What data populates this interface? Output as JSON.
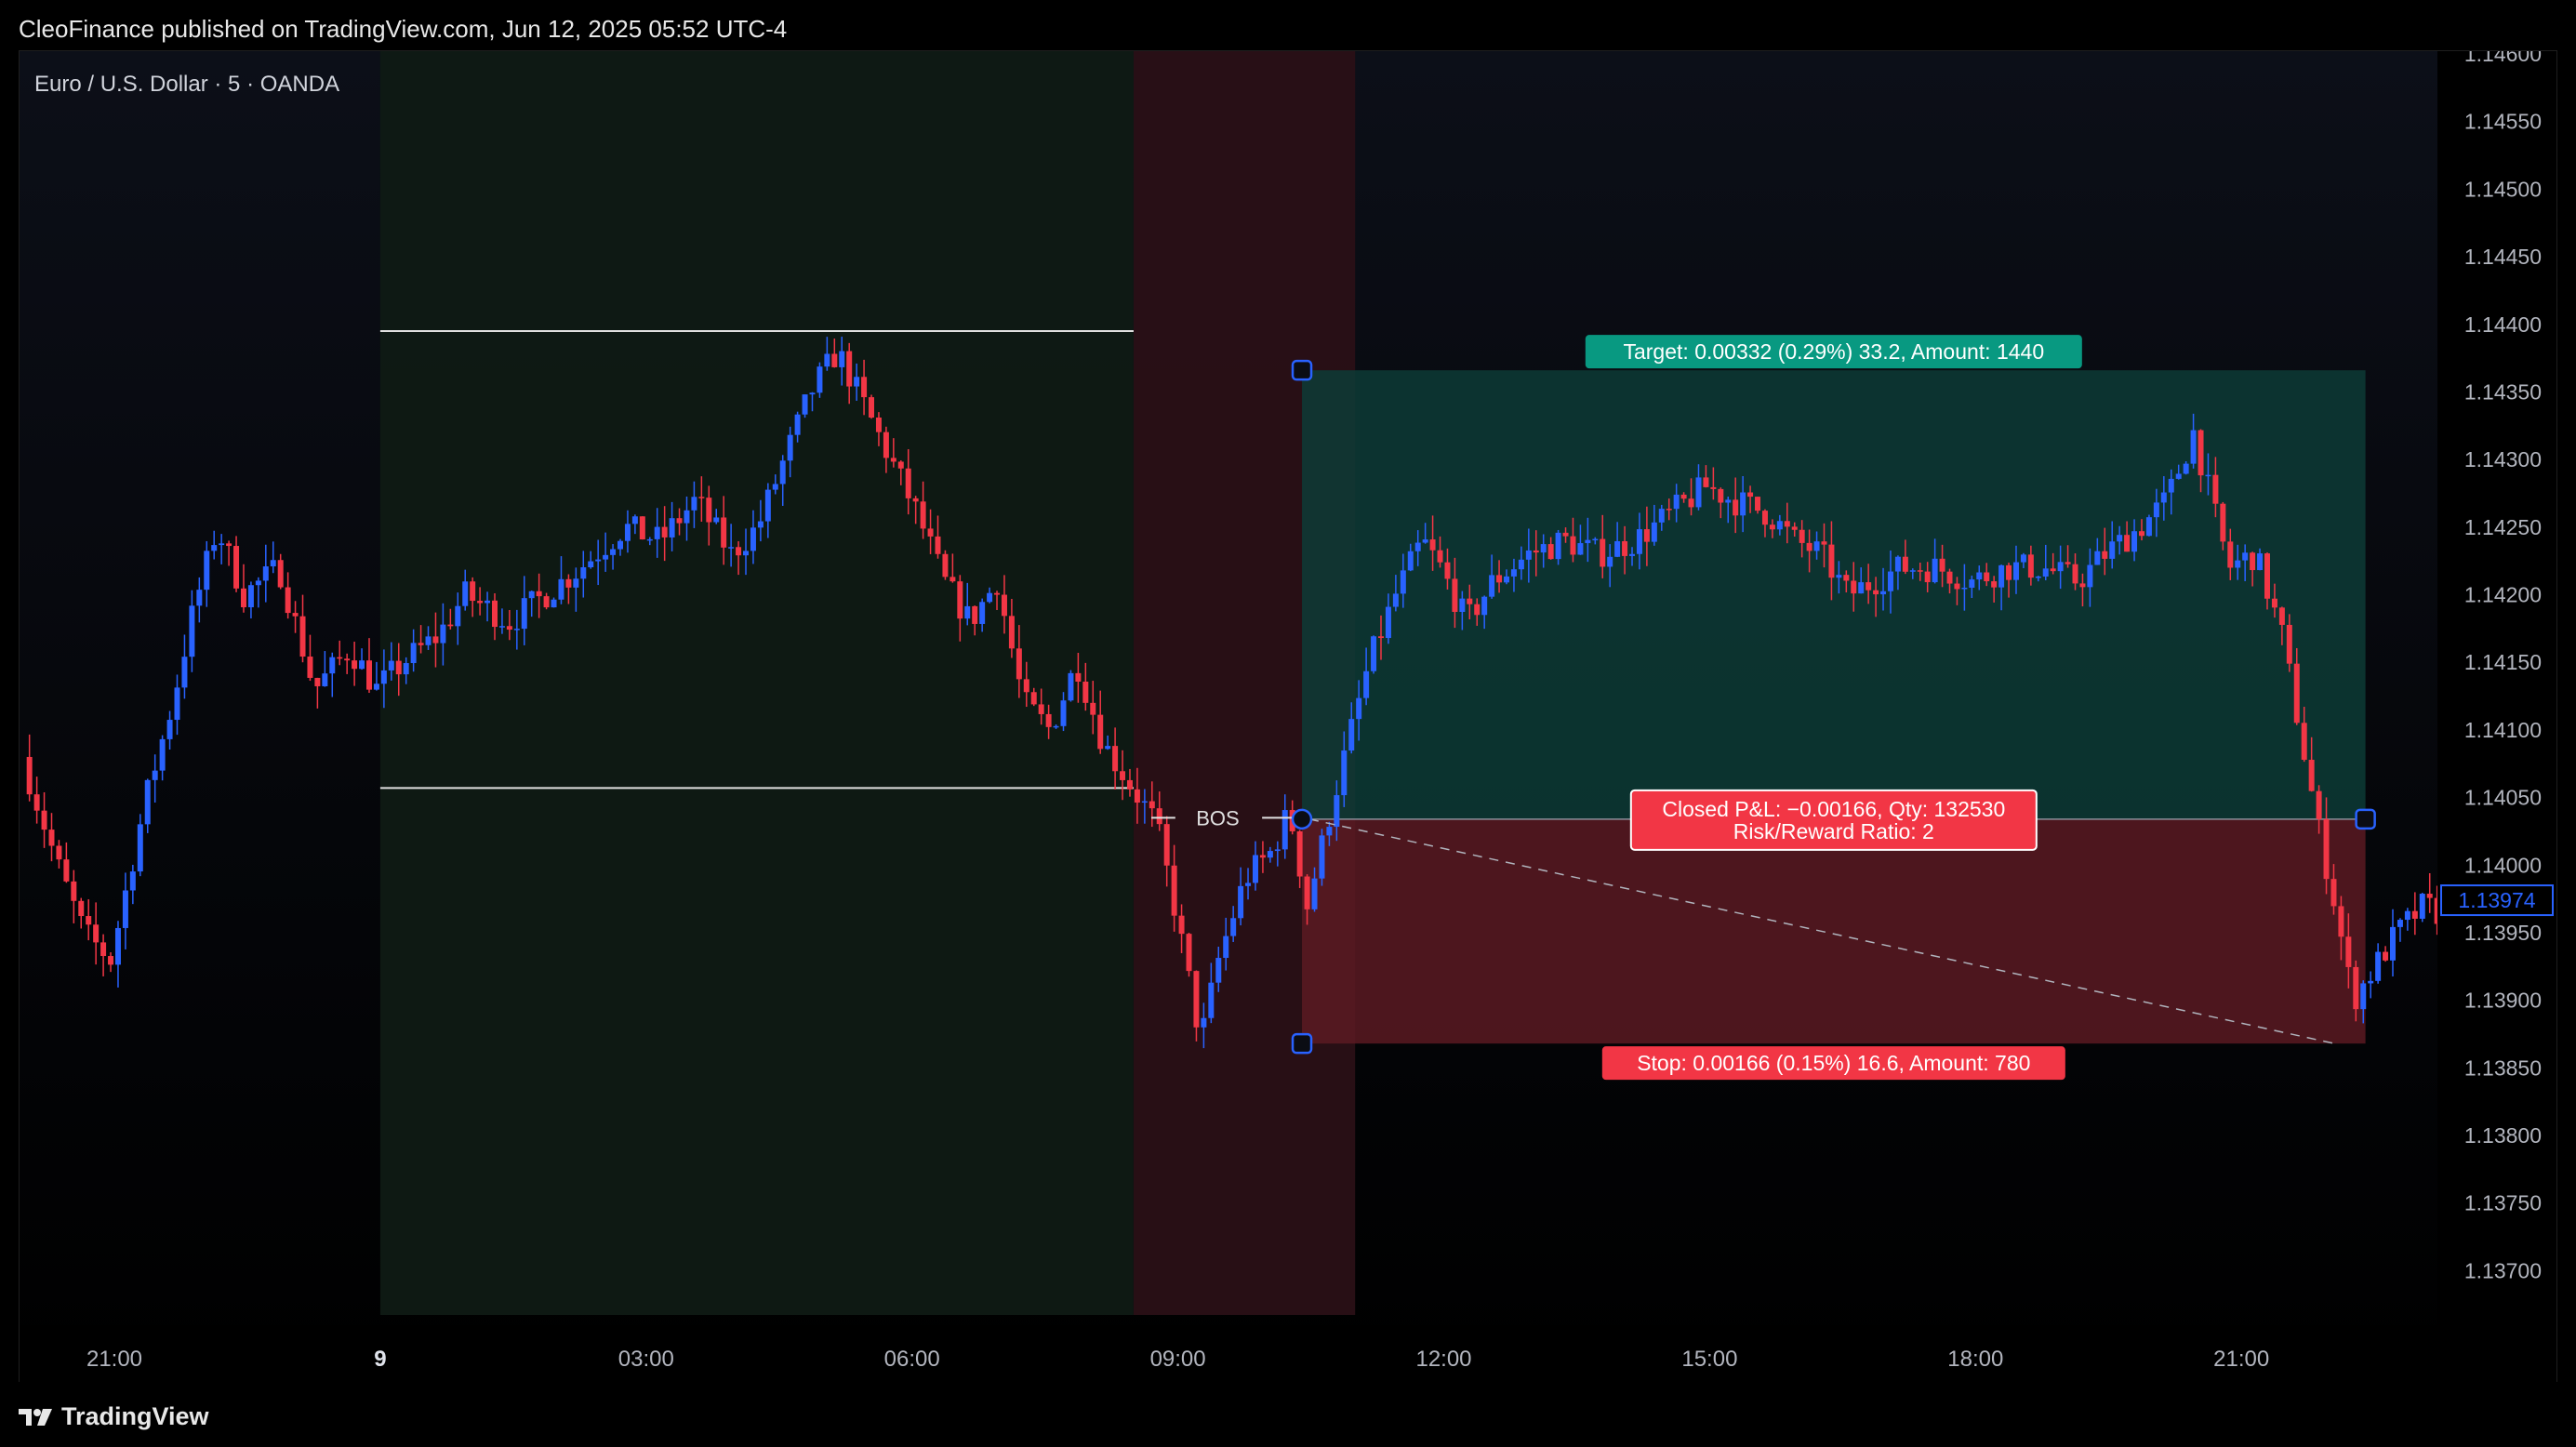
{
  "header": {
    "publisher": "CleoFinance published on TradingView.com, Jun 12, 2025 05:52 UTC-4"
  },
  "symbol": {
    "title": "Euro / U.S. Dollar · 5 · OANDA"
  },
  "footer": {
    "brand": "TradingView",
    "logo_icon": "tradingview-logo-icon"
  },
  "colors": {
    "up": "#2962ff",
    "down": "#f23645",
    "background": "#000000",
    "session_green": "#0f1a14",
    "session_red": "#2a1016",
    "target_fill": "#0d3b36",
    "stop_fill": "#5a1a22",
    "target_label": "#089981",
    "stop_label": "#f23645",
    "current_price": "#2962ff"
  },
  "chart_data": {
    "type": "candlestick",
    "symbol": "Euro / U.S. Dollar · 5 · OANDA",
    "ylim": [
      1.1367,
      1.146
    ],
    "y_ticks": [
      "1.14600",
      "1.14550",
      "1.14500",
      "1.14450",
      "1.14400",
      "1.14350",
      "1.14300",
      "1.14250",
      "1.14200",
      "1.14150",
      "1.14100",
      "1.14050",
      "1.14000",
      "1.13950",
      "1.13900",
      "1.13850",
      "1.13800",
      "1.13750",
      "1.13700"
    ],
    "x_ticks": [
      {
        "label": "21:00",
        "hour": -3
      },
      {
        "label": "9",
        "hour": 0,
        "bold": true
      },
      {
        "label": "03:00",
        "hour": 3
      },
      {
        "label": "06:00",
        "hour": 6
      },
      {
        "label": "09:00",
        "hour": 9
      },
      {
        "label": "12:00",
        "hour": 12
      },
      {
        "label": "15:00",
        "hour": 15
      },
      {
        "label": "18:00",
        "hour": 18
      },
      {
        "label": "21:00",
        "hour": 21
      }
    ],
    "price_path": [
      [
        -4,
        1.1408
      ],
      [
        -3.6,
        1.14
      ],
      [
        -3.3,
        1.1395
      ],
      [
        -3.0,
        1.1393
      ],
      [
        -2.6,
        1.1405
      ],
      [
        -2.3,
        1.1412
      ],
      [
        -2.1,
        1.1418
      ],
      [
        -1.8,
        1.1425
      ],
      [
        -1.5,
        1.142
      ],
      [
        -1.1,
        1.1422
      ],
      [
        -0.7,
        1.1413
      ],
      [
        -0.3,
        1.1416
      ],
      [
        0.0,
        1.1413
      ],
      [
        0.3,
        1.1415
      ],
      [
        0.7,
        1.1417
      ],
      [
        1.0,
        1.142
      ],
      [
        1.5,
        1.1418
      ],
      [
        1.9,
        1.142
      ],
      [
        2.3,
        1.1422
      ],
      [
        2.8,
        1.1425
      ],
      [
        3.2,
        1.1424
      ],
      [
        3.6,
        1.1427
      ],
      [
        4.0,
        1.1423
      ],
      [
        4.3,
        1.1425
      ],
      [
        4.6,
        1.143
      ],
      [
        4.9,
        1.1435
      ],
      [
        5.2,
        1.1438
      ],
      [
        5.5,
        1.1434
      ],
      [
        5.8,
        1.143
      ],
      [
        6.1,
        1.1426
      ],
      [
        6.4,
        1.1421
      ],
      [
        6.7,
        1.1418
      ],
      [
        7.0,
        1.1421
      ],
      [
        7.3,
        1.1412
      ],
      [
        7.6,
        1.141
      ],
      [
        7.9,
        1.1415
      ],
      [
        8.2,
        1.1409
      ],
      [
        8.5,
        1.1406
      ],
      [
        8.8,
        1.1403
      ],
      [
        9.0,
        1.1397
      ],
      [
        9.3,
        1.1387
      ],
      [
        9.5,
        1.1393
      ],
      [
        9.8,
        1.1399
      ],
      [
        10.1,
        1.1401
      ],
      [
        10.3,
        1.1404
      ],
      [
        10.5,
        1.1397
      ],
      [
        10.8,
        1.1405
      ],
      [
        11.0,
        1.141
      ],
      [
        11.2,
        1.1415
      ],
      [
        11.5,
        1.142
      ],
      [
        11.8,
        1.1424
      ],
      [
        12.0,
        1.1422
      ],
      [
        12.3,
        1.1418
      ],
      [
        12.6,
        1.1421
      ],
      [
        13.0,
        1.1423
      ],
      [
        13.4,
        1.1424
      ],
      [
        13.8,
        1.1423
      ],
      [
        14.2,
        1.1424
      ],
      [
        14.6,
        1.1426
      ],
      [
        15.0,
        1.1428
      ],
      [
        15.3,
        1.1427
      ],
      [
        15.7,
        1.1426
      ],
      [
        16.0,
        1.1424
      ],
      [
        16.3,
        1.1423
      ],
      [
        16.6,
        1.142
      ],
      [
        16.9,
        1.1421
      ],
      [
        17.2,
        1.1422
      ],
      [
        17.6,
        1.1422
      ],
      [
        18.0,
        1.1421
      ],
      [
        18.4,
        1.1422
      ],
      [
        18.8,
        1.1422
      ],
      [
        19.2,
        1.1421
      ],
      [
        19.5,
        1.1423
      ],
      [
        19.9,
        1.1425
      ],
      [
        20.2,
        1.1427
      ],
      [
        20.5,
        1.1432
      ],
      [
        20.7,
        1.1427
      ],
      [
        20.9,
        1.1422
      ],
      [
        21.2,
        1.1423
      ],
      [
        21.5,
        1.1417
      ],
      [
        21.7,
        1.141
      ],
      [
        21.9,
        1.1403
      ],
      [
        22.1,
        1.1397
      ],
      [
        22.3,
        1.139
      ],
      [
        22.5,
        1.1392
      ],
      [
        22.8,
        1.1395
      ],
      [
        23.1,
        1.1397
      ],
      [
        23.4,
        1.1396
      ]
    ],
    "session_boxes": [
      {
        "name": "asia-session",
        "from_hour": 0,
        "to_hour": 8.5
      },
      {
        "name": "london-killzone",
        "from_hour": 8.5,
        "to_hour": 11.0
      }
    ],
    "levels": [
      {
        "name": "session-high",
        "price": 1.14395,
        "from_hour": 0,
        "to_hour": 8.5
      },
      {
        "name": "session-low",
        "price": 1.14057,
        "from_hour": 0,
        "to_hour": 8.5
      }
    ],
    "bos": {
      "label": "BOS",
      "price": 1.14035,
      "from_hour": 8.7,
      "to_hour": 10.4
    },
    "position": {
      "type": "short",
      "from_hour": 10.4,
      "to_hour": 22.4,
      "entry": 1.14034,
      "target_price": 1.14366,
      "stop_price": 1.13868,
      "exit_hour": 22.05,
      "exit_price": 1.13868,
      "target_label": "Target: 0.00332 (0.29%) 33.2, Amount: 1440",
      "stop_label": "Stop: 0.00166 (0.15%) 16.6, Amount: 780",
      "pnl_label": "Closed P&L: −0.00166, Qty: 132530",
      "rr_label": "Risk/Reward Ratio: 2"
    },
    "current_price": {
      "value": 1.13974,
      "label": "1.13974"
    }
  }
}
